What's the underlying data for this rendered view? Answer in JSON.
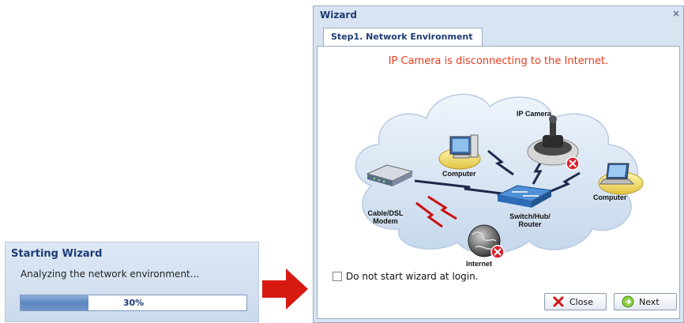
{
  "starting_wizard": {
    "title": "Starting Wizard",
    "status": "Analyzing the network environment...",
    "progress_text": "30%",
    "progress_value": 0.3
  },
  "wizard": {
    "title": "Wizard",
    "close_glyph": "×",
    "tab_label": "Step1. Network Environment",
    "status_message": "IP Camera is disconnecting to the Internet.",
    "diagram_labels": {
      "ip_camera": "IP Camera",
      "computer_left": "Computer",
      "computer_right": "Computer",
      "switch": "Switch/Hub/ Router",
      "modem": "Cable/DSL Modem",
      "internet": "Internet"
    },
    "checkbox_label": "Do not start wizard at login.",
    "checkbox_checked": false,
    "close_button": "Close",
    "next_button": "Next"
  },
  "colors": {
    "status_red": "#e53a1a",
    "title_blue": "#1d3c72",
    "arrow_red": "#d61a12"
  }
}
